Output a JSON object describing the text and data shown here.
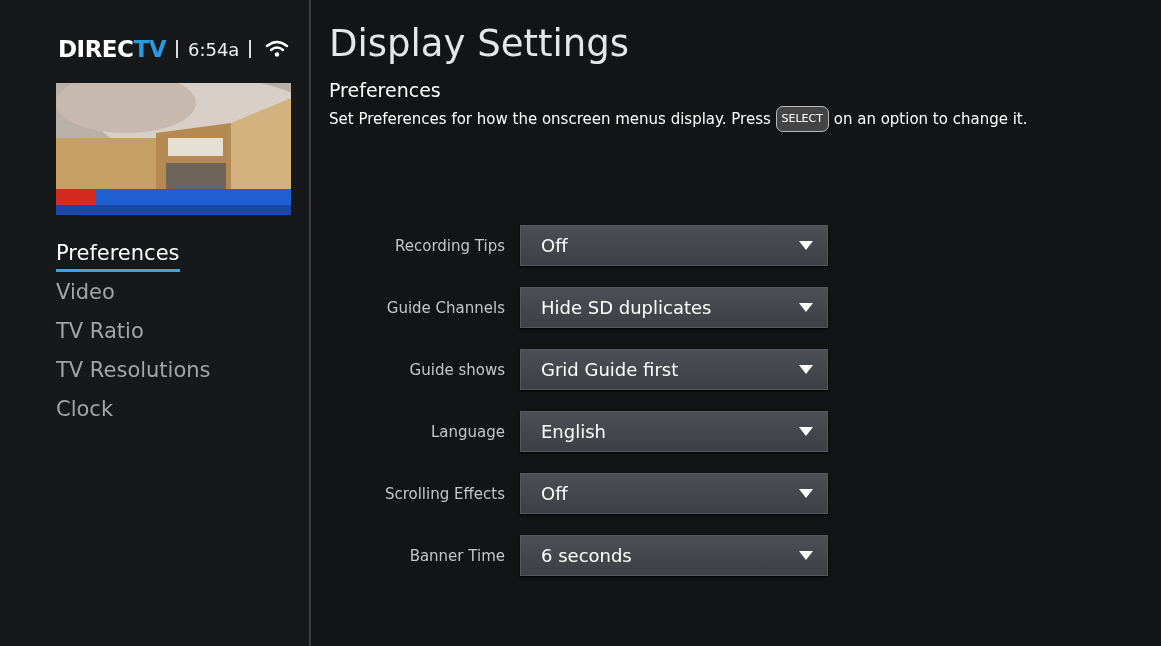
{
  "header": {
    "logo": "DIRECTV",
    "time": "6:54a"
  },
  "sidebar": {
    "items": [
      {
        "label": "Preferences",
        "selected": true
      },
      {
        "label": "Video",
        "selected": false
      },
      {
        "label": "TV Ratio",
        "selected": false
      },
      {
        "label": "TV Resolutions",
        "selected": false
      },
      {
        "label": "Clock",
        "selected": false
      }
    ]
  },
  "title": "Display Settings",
  "section": {
    "heading": "Preferences",
    "description_before": "Set Preferences for how the onscreen menus display. Press",
    "key": "SELECT",
    "description_after": "on an option to change it."
  },
  "settings": [
    {
      "label": "Recording Tips",
      "value": "Off"
    },
    {
      "label": "Guide Channels",
      "value": "Hide SD duplicates"
    },
    {
      "label": "Guide shows",
      "value": "Grid Guide first"
    },
    {
      "label": "Language",
      "value": "English"
    },
    {
      "label": "Scrolling Effects",
      "value": "Off"
    },
    {
      "label": "Banner Time",
      "value": "6 seconds"
    }
  ]
}
